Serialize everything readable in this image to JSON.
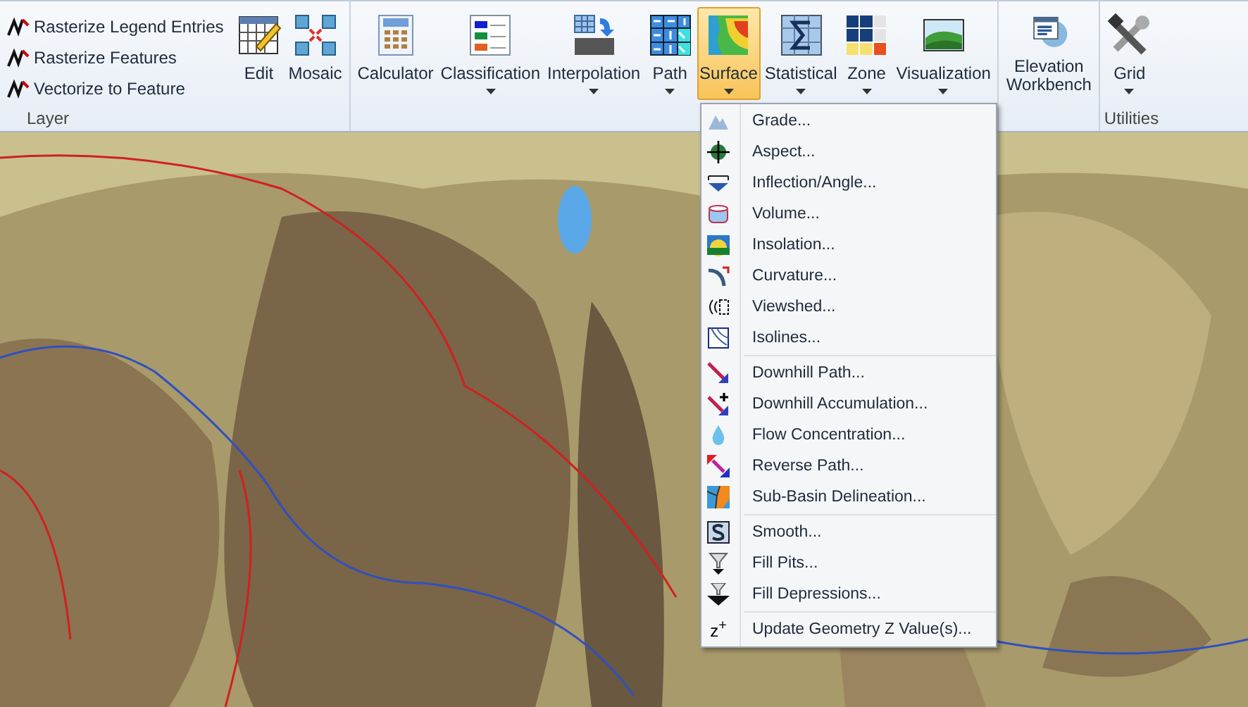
{
  "ribbon": {
    "groups": [
      {
        "label": "Layer",
        "small_items": [
          {
            "label": "Rasterize Legend Entries"
          },
          {
            "label": "Rasterize Features"
          },
          {
            "label": "Vectorize to Feature"
          }
        ],
        "large_items": [
          {
            "label": "Edit",
            "has_dropdown": false,
            "selected": false
          },
          {
            "label": "Mosaic",
            "has_dropdown": false,
            "selected": false
          }
        ]
      },
      {
        "large_items": [
          {
            "label": "Calculator",
            "has_dropdown": false,
            "selected": false
          },
          {
            "label": "Classification",
            "has_dropdown": true,
            "selected": false
          },
          {
            "label": "Interpolation",
            "has_dropdown": true,
            "selected": false
          },
          {
            "label": "Path",
            "has_dropdown": true,
            "selected": false
          },
          {
            "label": "Surface",
            "has_dropdown": true,
            "selected": true
          },
          {
            "label": "Statistical",
            "has_dropdown": true,
            "selected": false
          },
          {
            "label": "Zone",
            "has_dropdown": true,
            "selected": false
          },
          {
            "label": "Visualization",
            "has_dropdown": true,
            "selected": false
          }
        ]
      },
      {
        "large_items": [
          {
            "label": "Elevation\nWorkbench",
            "has_dropdown": false,
            "selected": false
          }
        ]
      },
      {
        "label": "Utilities",
        "large_items": [
          {
            "label": "Grid",
            "has_dropdown": true,
            "selected": false
          }
        ]
      }
    ]
  },
  "surface_menu": {
    "sections": [
      [
        {
          "label": "Grade..."
        },
        {
          "label": "Aspect..."
        },
        {
          "label": "Inflection/Angle..."
        },
        {
          "label": "Volume..."
        },
        {
          "label": "Insolation..."
        },
        {
          "label": "Curvature..."
        },
        {
          "label": "Viewshed..."
        },
        {
          "label": "Isolines..."
        }
      ],
      [
        {
          "label": "Downhill Path..."
        },
        {
          "label": "Downhill Accumulation..."
        },
        {
          "label": "Flow Concentration..."
        },
        {
          "label": "Reverse Path..."
        },
        {
          "label": "Sub-Basin Delineation..."
        }
      ],
      [
        {
          "label": "Smooth..."
        },
        {
          "label": "Fill Pits..."
        },
        {
          "label": "Fill Depressions..."
        }
      ],
      [
        {
          "label": "Update Geometry Z Value(s)...",
          "kind": "text-icon",
          "icon_text": "z$^{+}$"
        }
      ]
    ]
  }
}
